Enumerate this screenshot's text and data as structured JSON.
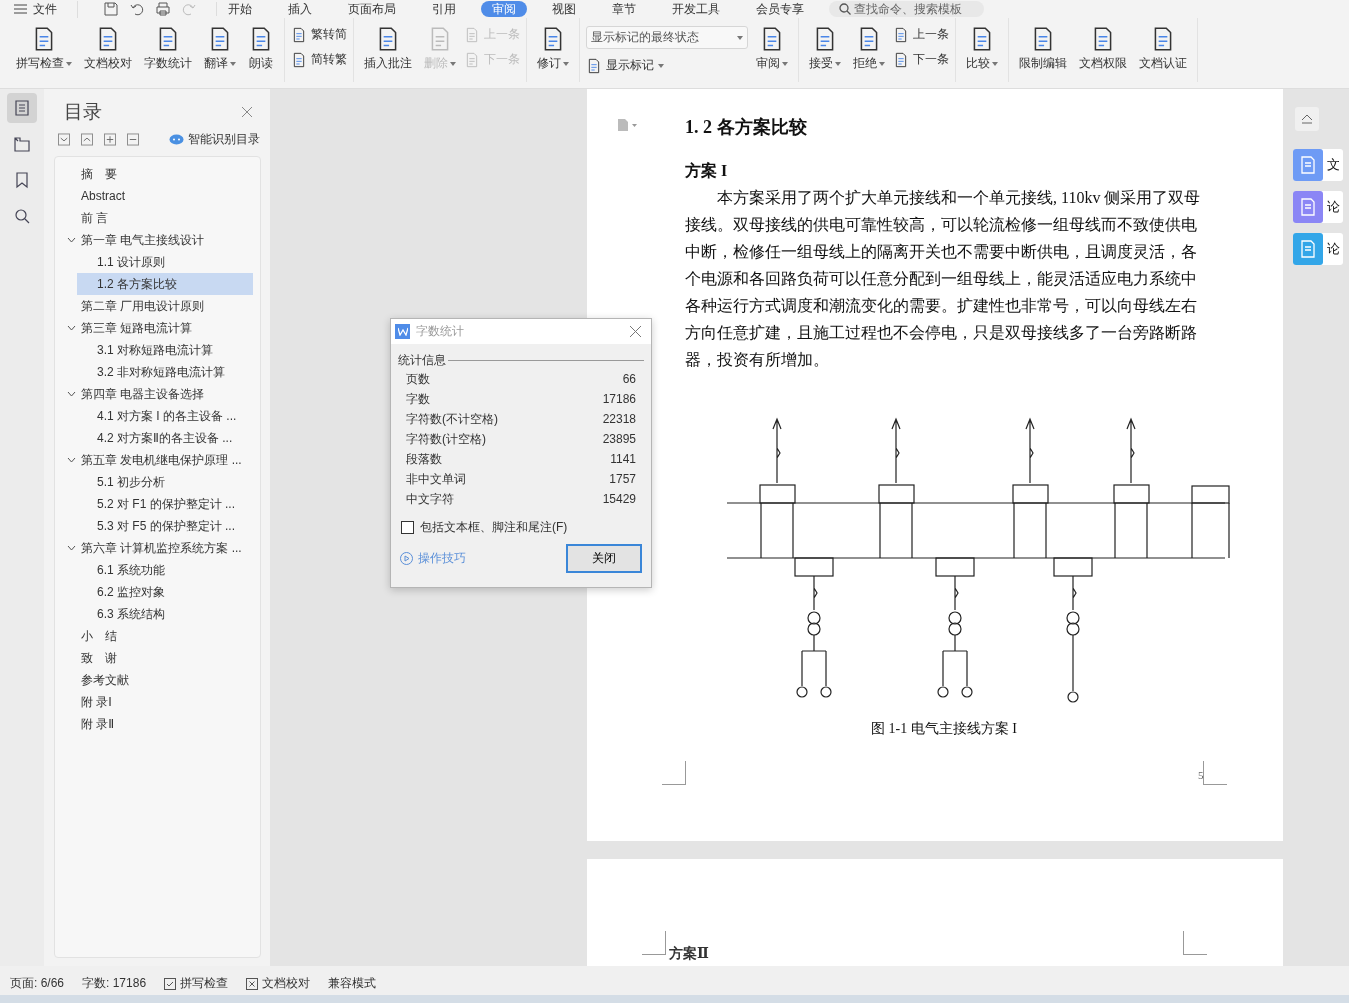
{
  "menu_bar": {
    "file_label": "文件",
    "tabs": [
      {
        "label": "开始",
        "selected": false
      },
      {
        "label": "插入",
        "selected": false
      },
      {
        "label": "页面布局",
        "selected": false
      },
      {
        "label": "引用",
        "selected": false
      },
      {
        "label": "审阅",
        "selected": true
      },
      {
        "label": "视图",
        "selected": false
      },
      {
        "label": "章节",
        "selected": false
      },
      {
        "label": "开发工具",
        "selected": false
      },
      {
        "label": "会员专享",
        "selected": false
      }
    ],
    "search": {
      "placeholder": "查找命令、搜索模板"
    }
  },
  "ribbon": {
    "groups": [
      [
        {
          "kind": "big",
          "label": "拼写检查",
          "dropdown": true,
          "disabled": false
        },
        {
          "kind": "big",
          "label": "文档校对",
          "dropdown": false,
          "disabled": false
        },
        {
          "kind": "big",
          "label": "字数统计",
          "dropdown": false,
          "disabled": false
        },
        {
          "kind": "big",
          "label": "翻译",
          "dropdown": true,
          "disabled": false
        },
        {
          "kind": "big",
          "label": "朗读",
          "dropdown": false,
          "disabled": false
        }
      ],
      [
        {
          "kind": "stack",
          "items": [
            {
              "kind": "small",
              "label": "繁转简",
              "dropdown": false,
              "disabled": false
            },
            {
              "kind": "small",
              "label": "简转繁",
              "dropdown": false,
              "disabled": false
            }
          ]
        }
      ],
      [
        {
          "kind": "big",
          "label": "插入批注",
          "dropdown": false,
          "disabled": false
        },
        {
          "kind": "big",
          "label": "删除",
          "dropdown": true,
          "disabled": true
        },
        {
          "kind": "stack",
          "items": [
            {
              "kind": "small",
              "label": "上一条",
              "dropdown": false,
              "disabled": true
            },
            {
              "kind": "small",
              "label": "下一条",
              "dropdown": false,
              "disabled": true
            }
          ]
        }
      ],
      [
        {
          "kind": "big",
          "label": "修订",
          "dropdown": true,
          "disabled": false
        }
      ],
      [
        {
          "kind": "stack",
          "items": [
            {
              "kind": "select",
              "value": "显示标记的最终状态"
            },
            {
              "kind": "small",
              "label": "显示标记",
              "dropdown": true,
              "disabled": false
            }
          ]
        },
        {
          "kind": "big",
          "label": "审阅",
          "dropdown": true,
          "disabled": false
        }
      ],
      [
        {
          "kind": "big",
          "label": "接受",
          "dropdown": true,
          "disabled": false
        },
        {
          "kind": "big",
          "label": "拒绝",
          "dropdown": true,
          "disabled": false
        },
        {
          "kind": "stack",
          "items": [
            {
              "kind": "small",
              "label": "上一条",
              "dropdown": false,
              "disabled": false
            },
            {
              "kind": "small",
              "label": "下一条",
              "dropdown": false,
              "disabled": false
            }
          ]
        }
      ],
      [
        {
          "kind": "big",
          "label": "比较",
          "dropdown": true,
          "disabled": false
        }
      ],
      [
        {
          "kind": "big",
          "label": "限制编辑",
          "dropdown": false,
          "disabled": false
        },
        {
          "kind": "big",
          "label": "文档权限",
          "dropdown": false,
          "disabled": false
        },
        {
          "kind": "big",
          "label": "文档认证",
          "dropdown": false,
          "disabled": false
        }
      ]
    ]
  },
  "left_rail": [
    {
      "selected": true
    },
    {
      "selected": false
    },
    {
      "selected": false
    },
    {
      "selected": false
    }
  ],
  "toc_panel": {
    "title": "目录",
    "smart_button": "智能识别目录",
    "items": [
      {
        "label": "摘　要",
        "selected": false
      },
      {
        "label": "Abstract",
        "selected": false
      },
      {
        "label": "前 言",
        "selected": false
      },
      {
        "label": "第一章  电气主接线设计",
        "selected": false,
        "expanded": true,
        "children": [
          {
            "label": "1.1  设计原则",
            "selected": false
          },
          {
            "label": "1.2  各方案比较",
            "selected": true
          }
        ]
      },
      {
        "label": "第二章  厂用电设计原则",
        "selected": false
      },
      {
        "label": "第三章  短路电流计算",
        "selected": false,
        "expanded": true,
        "children": [
          {
            "label": "3.1  对称短路电流计算",
            "selected": false
          },
          {
            "label": "3.2  非对称短路电流计算",
            "selected": false
          }
        ]
      },
      {
        "label": "第四章  电器主设备选择",
        "selected": false,
        "expanded": true,
        "children": [
          {
            "label": "4.1 对方案 I 的各主设备 ...",
            "selected": false
          },
          {
            "label": "4.2  对方案Ⅱ的各主设备 ...",
            "selected": false
          }
        ]
      },
      {
        "label": "第五章  发电机继电保护原理 ...",
        "selected": false,
        "expanded": true,
        "children": [
          {
            "label": "5.1  初步分析",
            "selected": false
          },
          {
            "label": "5.2  对 F1  的保护整定计 ...",
            "selected": false
          },
          {
            "label": "5.3  对 F5 的保护整定计 ...",
            "selected": false
          }
        ]
      },
      {
        "label": "第六章  计算机监控系统方案 ...",
        "selected": false,
        "expanded": true,
        "children": [
          {
            "label": "6.1  系统功能",
            "selected": false
          },
          {
            "label": "6.2  监控对象",
            "selected": false
          },
          {
            "label": "6.3  系统结构",
            "selected": false
          }
        ]
      },
      {
        "label": "小　结",
        "selected": false
      },
      {
        "label": "致　谢",
        "selected": false
      },
      {
        "label": "参考文献",
        "selected": false
      },
      {
        "label": "附  录Ⅰ",
        "selected": false
      },
      {
        "label": "附  录Ⅱ",
        "selected": false
      }
    ]
  },
  "document": {
    "heading": "1. 2  各方案比较",
    "subheading": "方案 I",
    "paragraph": "本方案采用了两个扩大单元接线和一个单元接线, 110kv 侧采用了双母接线。双母接线的供电可靠性较高，可以轮流检修一组母线而不致使供电中断，检修任一组母线上的隔离开关也不需要中断供电，且调度灵活，各个电源和各回路负荷可以任意分配到一组母线上，能灵活适应电力系统中各种运行方式调度和潮流变化的需要。扩建性也非常号，可以向母线左右方向任意扩建，且施工过程也不会停电，只是双母接线多了一台旁路断路器，投资有所增加。",
    "figure_caption": "图 1-1  电气主接线方案 I",
    "page_number": "5",
    "next_page_heading": "方案Ⅱ"
  },
  "right_panel": {
    "tabs": [
      {
        "label": "文",
        "color": "#6e9bf5"
      },
      {
        "label": "论",
        "color": "#8b86f5"
      },
      {
        "label": "论",
        "color": "#33a6e8"
      }
    ]
  },
  "word_count_dialog": {
    "title": "字数统计",
    "section": "统计信息",
    "rows": [
      {
        "label": "页数",
        "value": "66"
      },
      {
        "label": "字数",
        "value": "17186"
      },
      {
        "label": "字符数(不计空格)",
        "value": "22318"
      },
      {
        "label": "字符数(计空格)",
        "value": "23895"
      },
      {
        "label": "段落数",
        "value": "1141"
      },
      {
        "label": "非中文单词",
        "value": "1757"
      },
      {
        "label": "中文字符",
        "value": "15429"
      }
    ],
    "checkbox": {
      "label": "包括文本框、脚注和尾注(F)",
      "checked": false
    },
    "tips_link": "操作技巧",
    "close_button": "关闭"
  },
  "status_bar": [
    {
      "kind": "text",
      "label": "页面: 6/66"
    },
    {
      "kind": "text",
      "label": "字数: 17186"
    },
    {
      "kind": "check",
      "label": "拼写检查"
    },
    {
      "kind": "box",
      "label": "文档校对"
    },
    {
      "kind": "text",
      "label": "兼容模式"
    }
  ]
}
